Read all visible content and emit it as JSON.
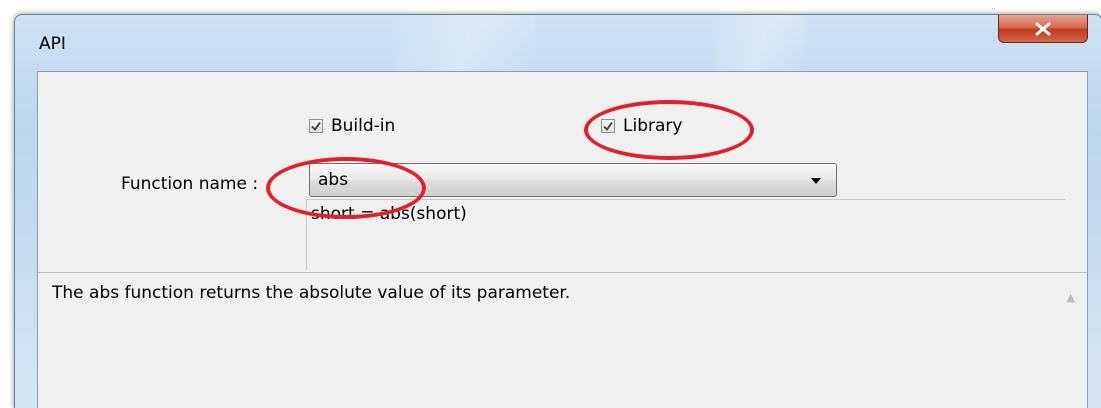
{
  "window": {
    "title": "API",
    "close_label": "close"
  },
  "options": {
    "buildin_label": "Build-in",
    "buildin_checked": true,
    "library_label": "Library",
    "library_checked": true
  },
  "function": {
    "label": "Function name :",
    "selected_value": "abs"
  },
  "signature": "short = abs(short)",
  "description": "The abs function returns the absolute value of its parameter.",
  "colors": {
    "highlight_ellipse": "#e0202a",
    "close_button": "#c0391f"
  },
  "icons": [
    "close-icon",
    "checkmark-icon",
    "dropdown-arrow-icon",
    "scroll-up-icon"
  ]
}
